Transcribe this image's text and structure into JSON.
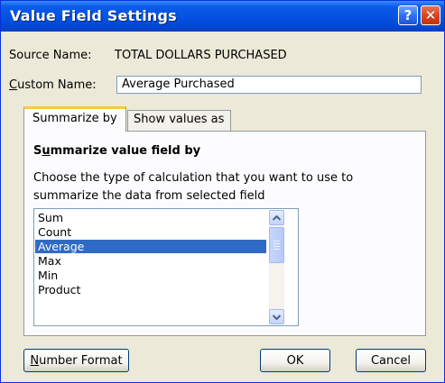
{
  "window": {
    "title": "Value Field Settings"
  },
  "titlebar": {
    "help_label": "?",
    "close_label": "✕"
  },
  "source": {
    "label": "Source Name:",
    "value": "TOTAL DOLLARS PURCHASED"
  },
  "custom_name": {
    "label_accel": "C",
    "label_rest": "ustom Name:",
    "value": "Average Purchased"
  },
  "tabs": [
    {
      "label": "Summarize by",
      "active": true
    },
    {
      "label": "Show values as",
      "active": false
    }
  ],
  "summarize": {
    "heading_before": "S",
    "heading_accel": "u",
    "heading_after": "mmarize value field by",
    "description": "Choose the type of calculation that you want to use to summarize the data from selected field",
    "items": [
      "Sum",
      "Count",
      "Average",
      "Max",
      "Min",
      "Product"
    ],
    "selected": "Average"
  },
  "buttons": {
    "number_format_accel": "N",
    "number_format_rest": "umber Format",
    "ok": "OK",
    "cancel": "Cancel"
  },
  "colors": {
    "titlebar": "#0552e3",
    "selection": "#316ac5",
    "dialog_bg": "#ece9d8"
  },
  "icons": {
    "help": "help-icon",
    "close": "close-icon",
    "scroll_up": "arrow-up-icon",
    "scroll_down": "arrow-down-icon"
  }
}
